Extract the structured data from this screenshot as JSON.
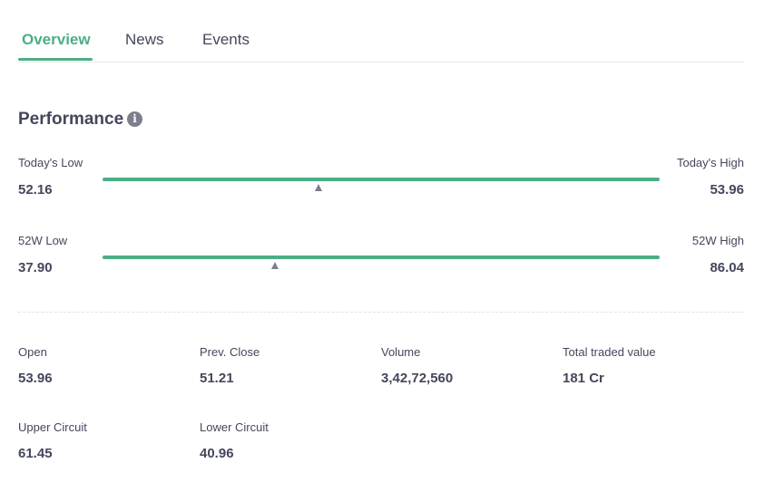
{
  "tabs": [
    {
      "label": "Overview",
      "active": true
    },
    {
      "label": "News",
      "active": false
    },
    {
      "label": "Events",
      "active": false
    }
  ],
  "performance": {
    "title": "Performance",
    "info_icon": "info-icon",
    "today": {
      "low_label": "Today's Low",
      "low_value": "52.16",
      "high_label": "Today's High",
      "high_value": "53.96",
      "marker_fraction": 0.387
    },
    "week52": {
      "low_label": "52W Low",
      "low_value": "37.90",
      "high_label": "52W High",
      "high_value": "86.04",
      "marker_fraction": 0.309
    }
  },
  "stats": [
    {
      "label": "Open",
      "value": "53.96"
    },
    {
      "label": "Prev. Close",
      "value": "51.21"
    },
    {
      "label": "Volume",
      "value": "3,42,72,560"
    },
    {
      "label": "Total traded value",
      "value": "181 Cr"
    },
    {
      "label": "Upper Circuit",
      "value": "61.45"
    },
    {
      "label": "Lower Circuit",
      "value": "40.96"
    }
  ],
  "colors": {
    "accent": "#4cae84",
    "text": "#44475b",
    "marker": "#7c7e8c",
    "divider": "#e9e9eb"
  }
}
